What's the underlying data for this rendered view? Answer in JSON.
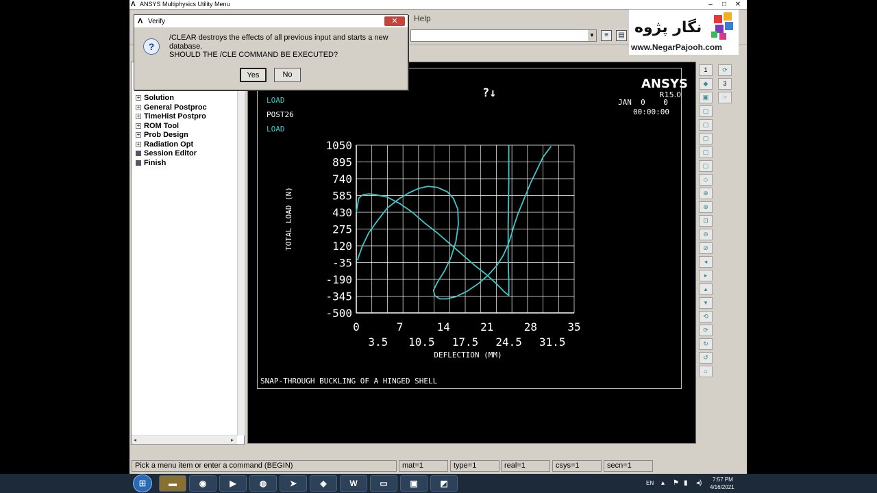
{
  "window": {
    "title": "ANSYS Multiphysics Utility Menu",
    "min": "–",
    "max": "□",
    "close": "✕"
  },
  "menubar": {
    "help": "Help"
  },
  "left_panel": {
    "items": [
      {
        "label": "Solution",
        "kind": "expand",
        "icon": "plus-box-icon"
      },
      {
        "label": "General Postproc",
        "kind": "expand",
        "icon": "plus-box-icon"
      },
      {
        "label": "TimeHist Postpro",
        "kind": "expand",
        "icon": "plus-box-icon"
      },
      {
        "label": "ROM Tool",
        "kind": "expand",
        "icon": "plus-box-icon"
      },
      {
        "label": "Prob Design",
        "kind": "expand",
        "icon": "plus-box-icon"
      },
      {
        "label": "Radiation Opt",
        "kind": "expand",
        "icon": "plus-box-icon"
      },
      {
        "label": "Session Editor",
        "kind": "doc",
        "icon": "document-icon"
      },
      {
        "label": "Finish",
        "kind": "doc",
        "icon": "document-icon"
      }
    ]
  },
  "graphics": {
    "logo": "ANSYS",
    "version": "R15.0",
    "header_lines": [
      "LOAD",
      "POST26",
      "LOAD"
    ],
    "date": "JAN  0    0",
    "time": "00:00:00",
    "footer_title": "SNAP-THROUGH BUCKLING OF A HINGED SHELL",
    "cursor_icon": "question-arrow-cursor-icon"
  },
  "chart_data": {
    "type": "line",
    "xlabel": "DEFLECTION (MM)",
    "ylabel": "TOTAL LOAD (N)",
    "xlim": [
      0,
      35
    ],
    "ylim": [
      -500,
      1050
    ],
    "x_ticks_top": [
      "0",
      "7",
      "14",
      "21",
      "28",
      "35"
    ],
    "x_ticks_bottom": [
      "3.5",
      "10.5",
      "17.5",
      "24.5",
      "31.5"
    ],
    "y_ticks": [
      "1050",
      "895",
      "740",
      "585",
      "430",
      "275",
      "120",
      "-35",
      "-190",
      "-345",
      "-500"
    ],
    "grid": true,
    "line_color": "#3fc8c8",
    "series": [
      {
        "x": [
          0.2,
          0.5,
          1,
          2,
          3.5,
          5,
          7,
          8.5,
          10,
          11.5,
          13,
          14.6,
          15.6,
          16.3,
          16.4,
          16,
          15.2,
          14.2,
          13.1,
          12.4,
          12.6,
          13.4,
          14.5,
          16,
          17.8,
          19.6,
          21.2,
          22.6,
          23.6,
          24.3,
          24.8,
          25.3,
          26,
          27,
          28,
          29,
          30,
          31.3
        ],
        "y": [
          -15,
          40,
          120,
          240,
          360,
          470,
          560,
          610,
          650,
          670,
          660,
          620,
          560,
          460,
          320,
          160,
          10,
          -110,
          -210,
          -290,
          -340,
          -370,
          -370,
          -350,
          -300,
          -230,
          -150,
          -60,
          30,
          120,
          200,
          300,
          420,
          560,
          700,
          820,
          940,
          1040
        ]
      },
      {
        "x": [
          0,
          0.4,
          1,
          2,
          3.3,
          5,
          7,
          9,
          11,
          13,
          15,
          17,
          19,
          21,
          22.5,
          23.7,
          24.5,
          24.5,
          24.4,
          24.4,
          24.5,
          24.5
        ],
        "y": [
          430,
          560,
          590,
          600,
          590,
          570,
          510,
          430,
          330,
          240,
          140,
          40,
          -60,
          -150,
          -230,
          -300,
          -340,
          -200,
          0,
          300,
          700,
          1050
        ]
      }
    ]
  },
  "right_toolbar": {
    "combo1": "1",
    "combo2": "3"
  },
  "status": {
    "prompt": "Pick a menu item or enter a command (BEGIN)",
    "mat": "mat=1",
    "type": "type=1",
    "real": "real=1",
    "csys": "csys=1",
    "secn": "secn=1"
  },
  "dialog": {
    "title": "Verify",
    "message_line1": "/CLEAR destroys the effects of all previous input and starts a new",
    "message_line2": "database.",
    "message_line3": "SHOULD THE /CLE COMMAND BE EXECUTED?",
    "yes": "Yes",
    "no": "No",
    "close": "✕"
  },
  "watermark": {
    "brand_fa": "نگار پژوه",
    "url": "www.NegarPajooh.com"
  },
  "taskbar": {
    "lang": "EN",
    "time": "7:57 PM",
    "date": "4/16/2021",
    "apps": [
      "folder-icon",
      "chrome-icon",
      "media-icon",
      "app-icon",
      "telegram-icon",
      "map-icon",
      "word-icon",
      "explorer-icon",
      "window-icon",
      "tool-icon"
    ]
  },
  "colors": {
    "plot_background": "#000000",
    "plot_line": "#3fc8c8",
    "window_chrome": "#d4d0c8"
  }
}
